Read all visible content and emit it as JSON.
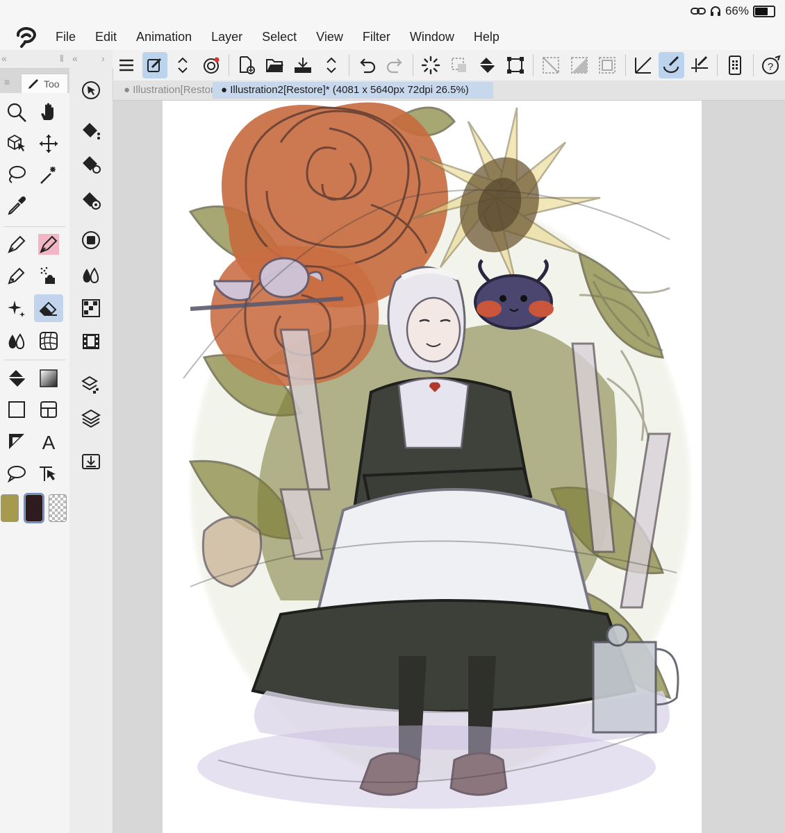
{
  "status": {
    "battery": "66%",
    "battery_level": 0.66
  },
  "menu": [
    "File",
    "Edit",
    "Animation",
    "Layer",
    "Select",
    "View",
    "Filter",
    "Window",
    "Help"
  ],
  "panel": {
    "tool_tab_label": "Too"
  },
  "tabs": [
    {
      "label": "Illustration[Restore]",
      "active": false
    },
    {
      "label": "Illustration2[Restore]* (4081 x 5640px 72dpi 26.5%)",
      "active": true
    }
  ],
  "colors": {
    "accent": "#bcd3ee",
    "main_color": "#a59a4e",
    "sub_color": "#2e1b1e"
  },
  "toolbar_icons": [
    "menu-icon",
    "quick-access-icon",
    "stepper-icon",
    "snapshot-icon",
    "new-file-icon",
    "open-folder-icon",
    "save-icon",
    "stepper-icon",
    "undo-icon",
    "redo-icon",
    "loading-icon",
    "deselect-icon",
    "fill-icon",
    "transform-icon",
    "clear-selection-icon",
    "invert-selection-icon",
    "selection-border-icon",
    "ruler-snap-icon",
    "brush-snap-icon",
    "line-snap-icon",
    "device-icon",
    "help-icon"
  ]
}
